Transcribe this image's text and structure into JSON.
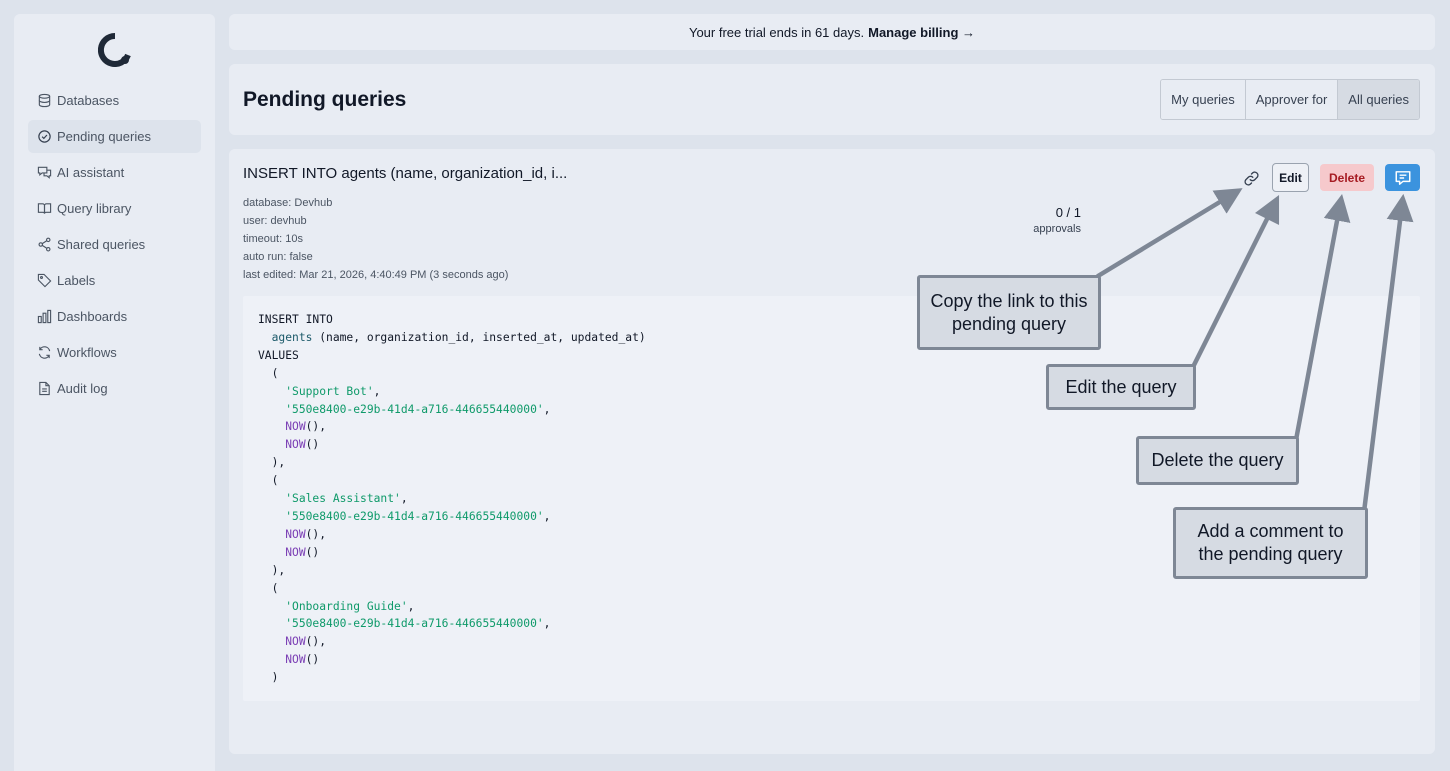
{
  "banner": {
    "text": "Your free trial ends in 61 days.",
    "link": "Manage billing →"
  },
  "sidebar": {
    "items": [
      {
        "label": "Databases",
        "icon": "database-icon"
      },
      {
        "label": "Pending queries",
        "icon": "pending-check-icon",
        "active": true
      },
      {
        "label": "AI assistant",
        "icon": "chat-bubbles-icon"
      },
      {
        "label": "Query library",
        "icon": "book-icon"
      },
      {
        "label": "Shared queries",
        "icon": "share-icon"
      },
      {
        "label": "Labels",
        "icon": "tag-icon"
      },
      {
        "label": "Dashboards",
        "icon": "bar-chart-icon"
      },
      {
        "label": "Workflows",
        "icon": "refresh-icon"
      },
      {
        "label": "Audit log",
        "icon": "document-icon"
      }
    ]
  },
  "header": {
    "title": "Pending queries",
    "filters": [
      "My queries",
      "Approver for",
      "All queries"
    ],
    "selected_filter": "All queries"
  },
  "query": {
    "title": "INSERT INTO agents (name, organization_id, i...",
    "meta": [
      {
        "key": "database:",
        "value": "Devhub"
      },
      {
        "key": "user:",
        "value": "devhub"
      },
      {
        "key": "timeout:",
        "value": "10s"
      },
      {
        "key": "auto run:",
        "value": "false"
      },
      {
        "key": "last edited:",
        "value": "Mar 21, 2026, 4:40:49 PM (3 seconds ago)"
      }
    ],
    "approvals_count": "0 / 1",
    "approvals_label": "approvals",
    "edit_label": "Edit",
    "delete_label": "Delete",
    "code": {
      "line1": "INSERT INTO",
      "table": "agents",
      "columns": " (name, organization_id, inserted_at, updated_at)",
      "values_kw": "VALUES",
      "rows": [
        {
          "name": "'Support Bot'",
          "org": "'550e8400-e29b-41d4-a716-446655440000'"
        },
        {
          "name": "'Sales Assistant'",
          "org": "'550e8400-e29b-41d4-a716-446655440000'"
        },
        {
          "name": "'Onboarding Guide'",
          "org": "'550e8400-e29b-41d4-a716-446655440000'"
        }
      ],
      "fn": "NOW"
    }
  },
  "tooltips": {
    "copy_link": "Copy the link to this pending query",
    "edit": "Edit the query",
    "delete": "Delete the query",
    "comment": "Add a comment to the pending query"
  },
  "colors": {
    "accent": "#3b93de",
    "danger_bg": "#f6c9cc",
    "danger_text": "#a61b22",
    "string": "#0f9a6a",
    "function": "#7b3fb5"
  }
}
